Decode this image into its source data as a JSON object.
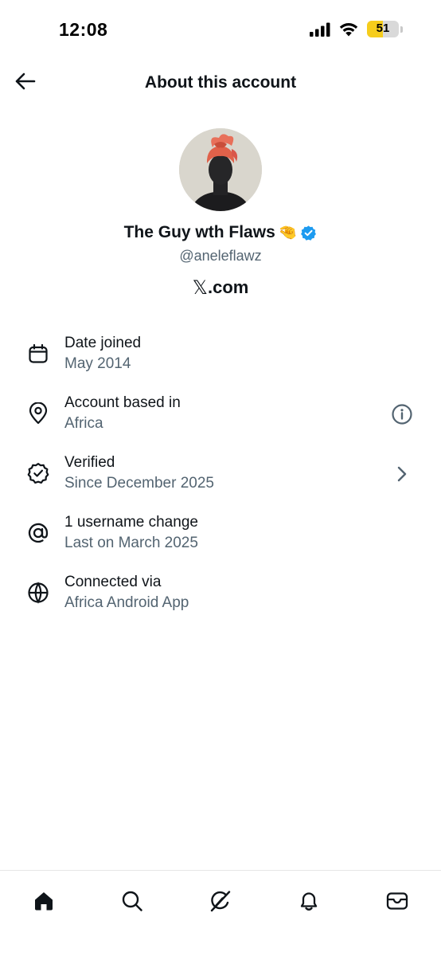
{
  "status_bar": {
    "time": "12:08",
    "battery_level": "51",
    "battery_fraction": 0.51,
    "battery_color": "#f6cd1c"
  },
  "header": {
    "title": "About this account",
    "back_icon": "arrow-left-icon"
  },
  "profile": {
    "display_name": "The Guy wth Flaws",
    "name_emoji": "🤏",
    "verified": true,
    "verified_color": "#1d9bf0",
    "username": "@aneleflawz",
    "site_prefix": "𝕏",
    "site_suffix": ".com"
  },
  "details": [
    {
      "icon": "calendar-icon",
      "title": "Date joined",
      "subtitle": "May 2014",
      "action": null
    },
    {
      "icon": "location-pin-icon",
      "title": "Account based in",
      "subtitle": "Africa",
      "action": "info-icon"
    },
    {
      "icon": "verified-outline-icon",
      "title": "Verified",
      "subtitle": "Since December 2025",
      "action": "chevron-right-icon"
    },
    {
      "icon": "at-sign-icon",
      "title": "1 username change",
      "subtitle": "Last on March 2025",
      "action": null
    },
    {
      "icon": "globe-icon",
      "title": "Connected via",
      "subtitle": "Africa Android App",
      "action": null
    }
  ],
  "bottom_nav": [
    {
      "icon": "home-icon",
      "active": true
    },
    {
      "icon": "search-icon",
      "active": false
    },
    {
      "icon": "grok-icon",
      "active": false
    },
    {
      "icon": "bell-icon",
      "active": false
    },
    {
      "icon": "mail-icon",
      "active": false
    }
  ],
  "colors": {
    "text_primary": "#0f1419",
    "text_secondary": "#536471",
    "background": "#ffffff"
  }
}
